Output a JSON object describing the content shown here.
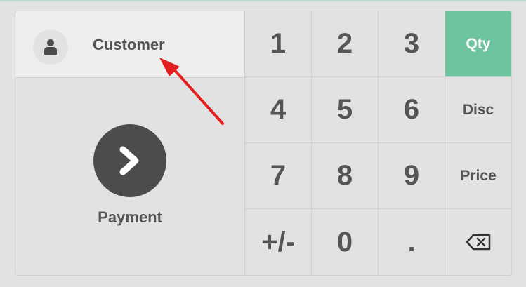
{
  "customer": {
    "label": "Customer",
    "icon": "user-icon"
  },
  "payment": {
    "label": "Payment",
    "icon": "chevron-right-icon"
  },
  "keypad": {
    "keys": [
      {
        "label": "1",
        "kind": "num"
      },
      {
        "label": "2",
        "kind": "num"
      },
      {
        "label": "3",
        "kind": "num"
      },
      {
        "label": "Qty",
        "kind": "mode",
        "active": true
      },
      {
        "label": "4",
        "kind": "num"
      },
      {
        "label": "5",
        "kind": "num"
      },
      {
        "label": "6",
        "kind": "num"
      },
      {
        "label": "Disc",
        "kind": "mode"
      },
      {
        "label": "7",
        "kind": "num"
      },
      {
        "label": "8",
        "kind": "num"
      },
      {
        "label": "9",
        "kind": "num"
      },
      {
        "label": "Price",
        "kind": "mode"
      },
      {
        "label": "+/-",
        "kind": "num"
      },
      {
        "label": "0",
        "kind": "num"
      },
      {
        "label": ".",
        "kind": "num"
      },
      {
        "label": "",
        "kind": "backspace",
        "icon": "backspace-icon"
      }
    ]
  },
  "colors": {
    "accent": "#6ec49e",
    "annotation_arrow": "#e31e1e"
  }
}
